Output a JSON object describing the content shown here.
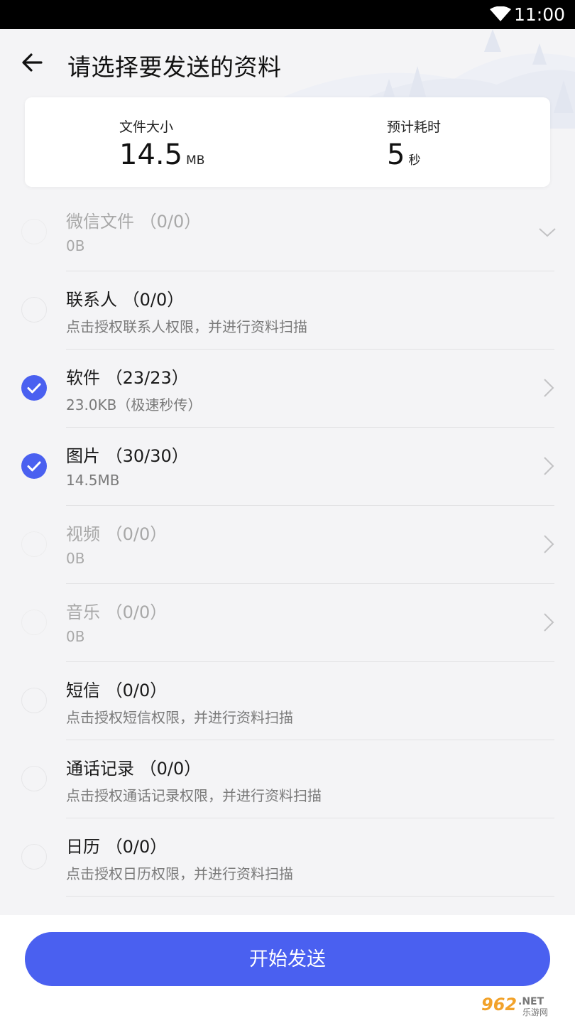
{
  "status_bar": {
    "time": "11:00"
  },
  "header": {
    "title": "请选择要发送的资料"
  },
  "summary": {
    "size_label": "文件大小",
    "size_value": "14.5",
    "size_unit": "MB",
    "time_label": "预计耗时",
    "time_value": "5",
    "time_unit": "秒"
  },
  "items": [
    {
      "title": "微信文件 （0/0）",
      "subtitle": "0B",
      "checked": false,
      "disabled": true,
      "indicator": "chevron-down"
    },
    {
      "title": "联系人 （0/0）",
      "subtitle": "点击授权联系人权限，并进行资料扫描",
      "checked": false,
      "disabled": false,
      "indicator": "none"
    },
    {
      "title": "软件 （23/23）",
      "subtitle": "23.0KB（极速秒传）",
      "checked": true,
      "disabled": false,
      "indicator": "chevron-right"
    },
    {
      "title": "图片 （30/30）",
      "subtitle": "14.5MB",
      "checked": true,
      "disabled": false,
      "indicator": "chevron-right"
    },
    {
      "title": "视频 （0/0）",
      "subtitle": "0B",
      "checked": false,
      "disabled": true,
      "indicator": "chevron-right"
    },
    {
      "title": "音乐 （0/0）",
      "subtitle": "0B",
      "checked": false,
      "disabled": true,
      "indicator": "chevron-right"
    },
    {
      "title": "短信 （0/0）",
      "subtitle": "点击授权短信权限，并进行资料扫描",
      "checked": false,
      "disabled": false,
      "indicator": "none"
    },
    {
      "title": "通话记录 （0/0）",
      "subtitle": "点击授权通话记录权限，并进行资料扫描",
      "checked": false,
      "disabled": false,
      "indicator": "none"
    },
    {
      "title": "日历 （0/0）",
      "subtitle": "点击授权日历权限，并进行资料扫描",
      "checked": false,
      "disabled": false,
      "indicator": "none"
    }
  ],
  "action": {
    "send_label": "开始发送"
  },
  "watermark": {
    "text": "962.NET 乐游网"
  },
  "colors": {
    "accent": "#4a60f0",
    "background": "#f4f4f6",
    "check": "#4a60f0"
  }
}
